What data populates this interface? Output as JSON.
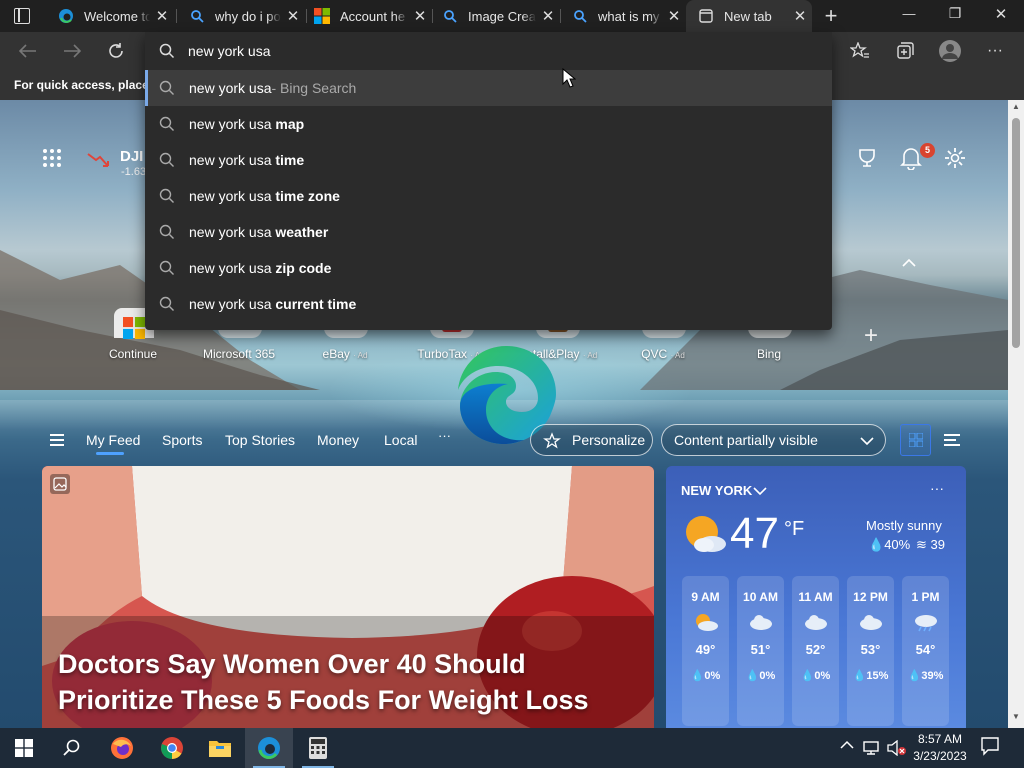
{
  "tabs": [
    {
      "title": "Welcome to",
      "favicon": "edge-icon"
    },
    {
      "title": "why do i po",
      "favicon": "bing-search-icon"
    },
    {
      "title": "Account he",
      "favicon": "microsoft-logo-icon"
    },
    {
      "title": "Image Crea",
      "favicon": "bing-search-icon"
    },
    {
      "title": "what is my",
      "favicon": "bing-search-icon"
    },
    {
      "title": "New tab",
      "favicon": "new-tab-icon",
      "active": true
    }
  ],
  "window_controls": {
    "minimize": "—",
    "maximize": "❐",
    "close": "✕"
  },
  "addressbar": {
    "value": "new york usa"
  },
  "favorites_bar": {
    "text": "For quick access, place y"
  },
  "suggestions": [
    {
      "prefix": "new york usa",
      "bold": "",
      "suffix": " - Bing Search",
      "selected": true
    },
    {
      "prefix": "new york usa ",
      "bold": "map",
      "suffix": ""
    },
    {
      "prefix": "new york usa ",
      "bold": "time",
      "suffix": ""
    },
    {
      "prefix": "new york usa ",
      "bold": "time zone",
      "suffix": ""
    },
    {
      "prefix": "new york usa ",
      "bold": "weather",
      "suffix": ""
    },
    {
      "prefix": "new york usa ",
      "bold": "zip code",
      "suffix": ""
    },
    {
      "prefix": "new york usa ",
      "bold": "current time",
      "suffix": ""
    }
  ],
  "stock": {
    "name": "DJI",
    "change": "-1.63"
  },
  "notifications": {
    "count": "5"
  },
  "shortcuts": [
    {
      "label": "Continue",
      "ad": ""
    },
    {
      "label": "Microsoft 365",
      "ad": ""
    },
    {
      "label": "eBay",
      "ad": "· Ad"
    },
    {
      "label": "TurboTax",
      "ad": "· Ad"
    },
    {
      "label": "Install&Play",
      "ad": "· Ad"
    },
    {
      "label": "QVC",
      "ad": "· Ad"
    },
    {
      "label": "Bing",
      "ad": ""
    }
  ],
  "feed": {
    "nav": [
      "My Feed",
      "Sports",
      "Top Stories",
      "Money",
      "Local"
    ],
    "more": "···",
    "personalize": "Personalize",
    "visibility": "Content partially visible"
  },
  "hero": {
    "headline": "Doctors Say Women Over 40 Should Prioritize These 5 Foods For Weight Loss"
  },
  "weather": {
    "location": "NEW YORK",
    "more": "···",
    "temp": "47",
    "unit": "°F",
    "condition": "Mostly sunny",
    "precip": "40%",
    "wind": "39",
    "hourly": [
      {
        "time": "9 AM",
        "temp": "49°",
        "precip": "0%",
        "icon": "partly-sunny-icon"
      },
      {
        "time": "10 AM",
        "temp": "51°",
        "precip": "0%",
        "icon": "cloudy-icon"
      },
      {
        "time": "11 AM",
        "temp": "52°",
        "precip": "0%",
        "icon": "cloudy-icon"
      },
      {
        "time": "12 PM",
        "temp": "53°",
        "precip": "15%",
        "icon": "cloudy-icon"
      },
      {
        "time": "1 PM",
        "temp": "54°",
        "precip": "39%",
        "icon": "rain-icon"
      }
    ]
  },
  "clock": {
    "time": "8:57 AM",
    "date": "3/23/2023"
  },
  "colors": {
    "accent": "#3b78e7",
    "edge_blue": "#0c59a4",
    "edge_green": "#35c05b"
  }
}
